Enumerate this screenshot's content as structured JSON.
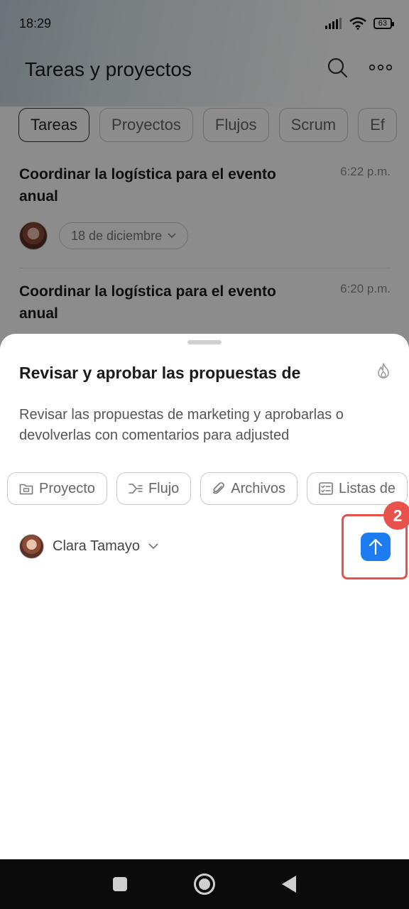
{
  "status_bar": {
    "time": "18:29",
    "battery": "63"
  },
  "app": {
    "title": "Tareas y proyectos",
    "tabs": [
      {
        "label": "Tareas",
        "active": true
      },
      {
        "label": "Proyectos",
        "active": false
      },
      {
        "label": "Flujos",
        "active": false
      },
      {
        "label": "Scrum",
        "active": false
      },
      {
        "label": "Ef",
        "active": false
      }
    ],
    "tasks": [
      {
        "title": "Coordinar la logística para el evento anual",
        "time": "6:22 p.m.",
        "date": "18 de diciembre"
      },
      {
        "title": "Coordinar la logística para el evento anual",
        "time": "6:20 p.m."
      }
    ]
  },
  "sheet": {
    "title": "Revisar y aprobar las propuestas de marketing",
    "description": "Revisar las propuestas de marketing y aprobarlas o devolverlas con comentarios para adjusted",
    "chips": [
      {
        "label": "Proyecto",
        "icon": "folder-icon"
      },
      {
        "label": "Flujo",
        "icon": "flow-icon"
      },
      {
        "label": "Archivos",
        "icon": "paperclip-icon"
      },
      {
        "label": "Listas de",
        "icon": "checklist-icon"
      }
    ],
    "assignee": "Clara Tamayo"
  },
  "annotation": {
    "step": "2",
    "color": "#e8524a"
  },
  "colors": {
    "accent": "#1e7cf2"
  }
}
